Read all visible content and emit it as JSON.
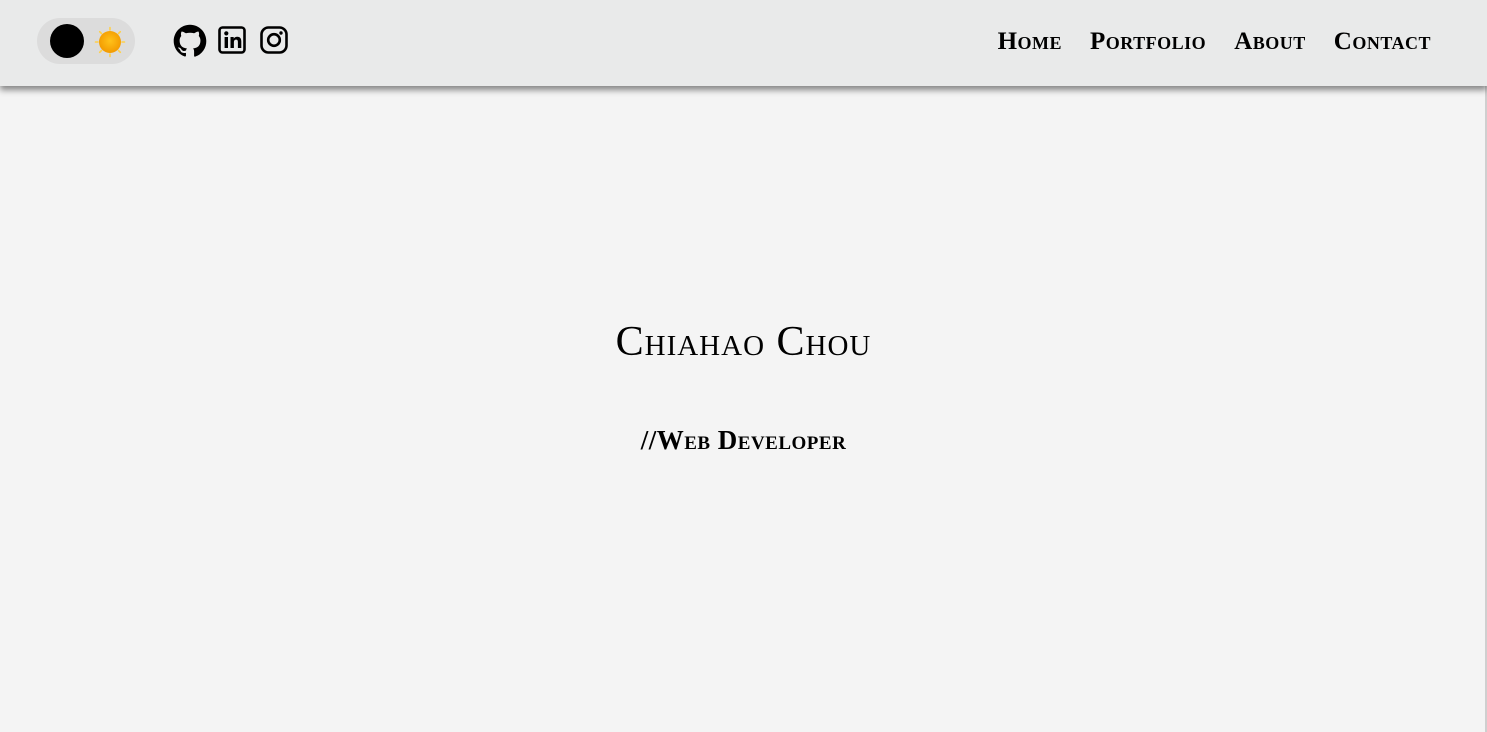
{
  "navbar": {
    "theme_toggle": {
      "state": "light",
      "knob_icon": "dark-mode-circle-icon",
      "sun_icon": "sun-icon",
      "sun_color": "#f6a400"
    },
    "social_icons": [
      {
        "name": "github-icon"
      },
      {
        "name": "linkedin-icon"
      },
      {
        "name": "instagram-icon"
      }
    ],
    "links": [
      {
        "label": "Home"
      },
      {
        "label": "Portfolio"
      },
      {
        "label": "About"
      },
      {
        "label": "Contact"
      }
    ]
  },
  "hero": {
    "name": "Chiahao Chou",
    "role": "//Web Developer"
  },
  "colors": {
    "navbar_bg": "#e9eaea",
    "page_bg": "#f4f4f4",
    "toggle_bg": "#dcdcdc",
    "text": "#000000"
  }
}
